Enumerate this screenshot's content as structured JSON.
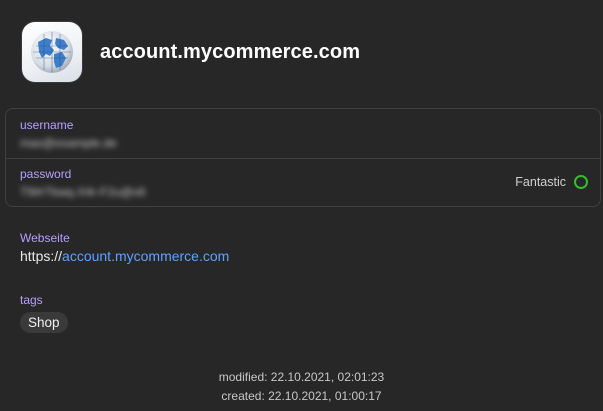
{
  "app": {
    "icon": "globe-icon",
    "title": "account.mycommerce.com"
  },
  "credentials": {
    "username": {
      "label": "username",
      "value": "max@example.de"
    },
    "password": {
      "label": "password",
      "value": "T9#rTkwq-X4r-F2u@x6",
      "strength_label": "Fantastic",
      "strength_color": "#2fbf2f"
    }
  },
  "website": {
    "label": "Webseite",
    "scheme": "https://",
    "host": "account.mycommerce.com"
  },
  "tags": {
    "label": "tags",
    "items": [
      "Shop"
    ]
  },
  "meta": {
    "modified": "modified: 22.10.2021, 02:01:23",
    "created": "created: 22.10.2021, 01:00:17"
  },
  "colors": {
    "background": "#272727",
    "label": "#b4a0ff",
    "link": "#5ea2ff",
    "strength_good": "#2fbf2f"
  }
}
